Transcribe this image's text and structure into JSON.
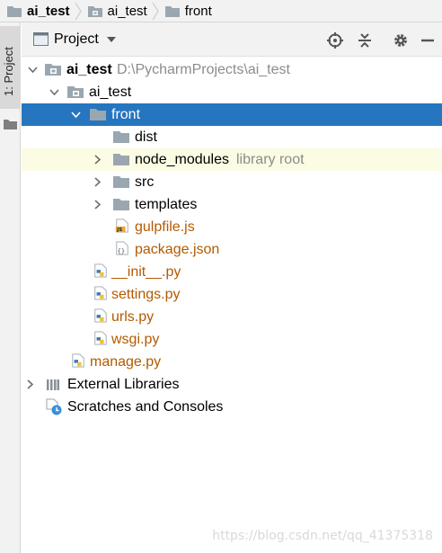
{
  "breadcrumb": [
    {
      "label": "ai_test",
      "bold": true
    },
    {
      "label": "ai_test"
    },
    {
      "label": "front"
    }
  ],
  "tool_stripe": {
    "label": "1: Project"
  },
  "header": {
    "title": "Project"
  },
  "tree": {
    "root": {
      "name": "ai_test",
      "path": "D:\\PycharmProjects\\ai_test"
    },
    "app_folder": "ai_test",
    "front_folder": "front",
    "front_children": [
      {
        "name": "dist"
      },
      {
        "name": "node_modules",
        "hint": "library root"
      },
      {
        "name": "src"
      },
      {
        "name": "templates"
      }
    ],
    "front_files": [
      "gulpfile.js",
      "package.json"
    ],
    "py_files": [
      "__init__.py",
      "settings.py",
      "urls.py",
      "wsgi.py"
    ],
    "manage": "manage.py",
    "external_libraries": "External Libraries",
    "scratches": "Scratches and Consoles"
  },
  "colors": {
    "selection": "#2675bf",
    "file_text": "#b35a00",
    "folder_icon": "#9aa7b0",
    "hint_row": "#fcfbe3"
  },
  "watermark": "https://blog.csdn.net/qq_41375318"
}
